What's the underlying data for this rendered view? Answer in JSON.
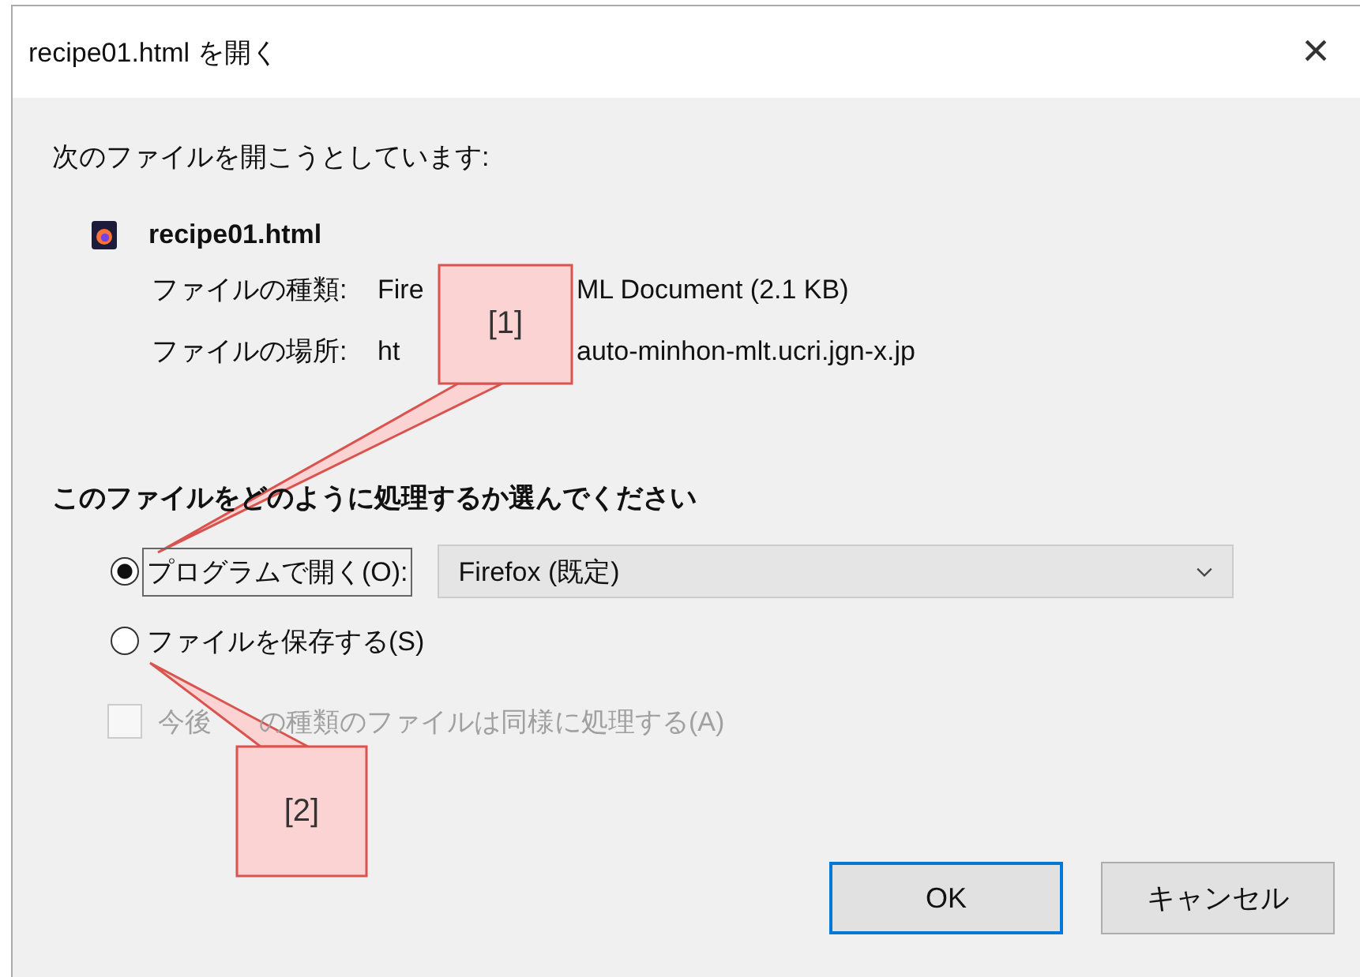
{
  "window": {
    "title": "recipe01.html を開く",
    "close": "×"
  },
  "intro": "次のファイルを開こうとしています:",
  "file": {
    "name": "recipe01.html",
    "details": [
      {
        "label": "ファイルの種類:",
        "parts": [
          "Fire",
          "ML Document (2.1 KB)"
        ]
      },
      {
        "label": "ファイルの場所:",
        "parts": [
          "ht",
          "auto-minhon-mlt.ucri.jgn-x.jp"
        ]
      }
    ]
  },
  "question": "このファイルをどのように処理するか選んでください",
  "options": [
    {
      "kind": "program",
      "label": "プログラムで開く(O):",
      "selected": true,
      "focused": true,
      "program": "Firefox (既定)"
    },
    {
      "kind": "save",
      "label": "ファイルを保存する(S)",
      "selected": false,
      "focused": false
    }
  ],
  "remember": {
    "parts": [
      "今後",
      "の種類のファイルは同様に処理する(A)"
    ],
    "checked": false,
    "disabled": true
  },
  "buttons": [
    {
      "label": "OK",
      "default": true
    },
    {
      "label": "キャンセル",
      "default": false
    }
  ],
  "callouts": [
    {
      "label": "[1]"
    },
    {
      "label": "[2]"
    }
  ]
}
